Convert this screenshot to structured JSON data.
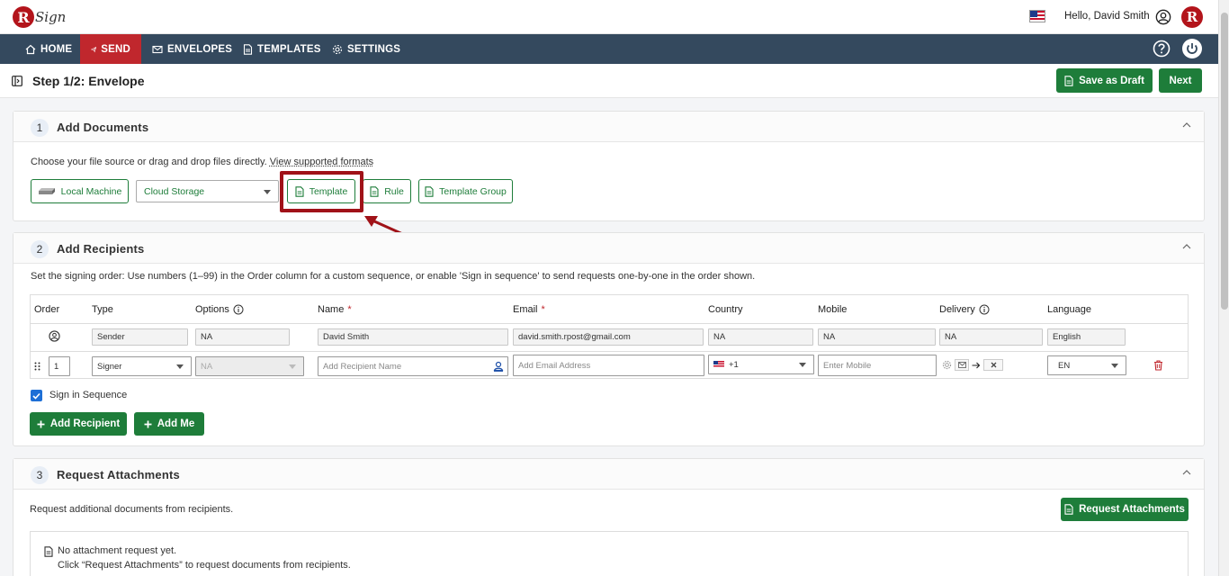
{
  "header": {
    "logo_text": "Sign",
    "greeting": "Hello, David Smith",
    "brand_letter": "R"
  },
  "nav": {
    "items": [
      {
        "label": "HOME"
      },
      {
        "label": "SEND"
      },
      {
        "label": "ENVELOPES"
      },
      {
        "label": "TEMPLATES"
      },
      {
        "label": "SETTINGS"
      }
    ]
  },
  "stepbar": {
    "title": "Step 1/2: Envelope",
    "save_draft": "Save as Draft",
    "next": "Next"
  },
  "documents": {
    "number": "1",
    "title": "Add Documents",
    "hint": "Choose your file source or drag and drop files directly.",
    "formats_link": "View supported formats",
    "local_machine": "Local Machine",
    "cloud_storage": "Cloud Storage",
    "template": "Template",
    "rule": "Rule",
    "template_group": "Template Group"
  },
  "recipients": {
    "number": "2",
    "title": "Add Recipients",
    "hint": "Set the signing order: Use numbers (1–99) in the Order column for a custom sequence, or enable 'Sign in sequence' to send requests one-by-one in the order shown.",
    "columns": {
      "order": "Order",
      "type": "Type",
      "options": "Options",
      "name": "Name",
      "email": "Email",
      "country": "Country",
      "mobile": "Mobile",
      "delivery": "Delivery",
      "language": "Language"
    },
    "sender_row": {
      "type": "Sender",
      "options": "NA",
      "name": "David Smith",
      "email": "david.smith.rpost@gmail.com",
      "country": "NA",
      "mobile": "NA",
      "delivery": "NA",
      "language": "English"
    },
    "signer_row": {
      "order": "1",
      "type": "Signer",
      "options": "NA",
      "name_placeholder": "Add Recipient Name",
      "email_placeholder": "Add Email Address",
      "country_code": "+1",
      "mobile_placeholder": "Enter Mobile",
      "language": "EN"
    },
    "sign_in_sequence": "Sign in Sequence",
    "add_recipient": "Add Recipient",
    "add_me": "Add Me"
  },
  "attachments": {
    "number": "3",
    "title": "Request Attachments",
    "hint": "Request additional documents from recipients.",
    "button": "Request Attachments",
    "empty_title": "No attachment request yet.",
    "empty_hint": "Click “Request Attachments” to request documents from recipients."
  },
  "colors": {
    "nav_bg": "#34495e",
    "nav_active": "#c0272d",
    "primary_green": "#1e7d3a",
    "highlight_red": "#a01218"
  }
}
